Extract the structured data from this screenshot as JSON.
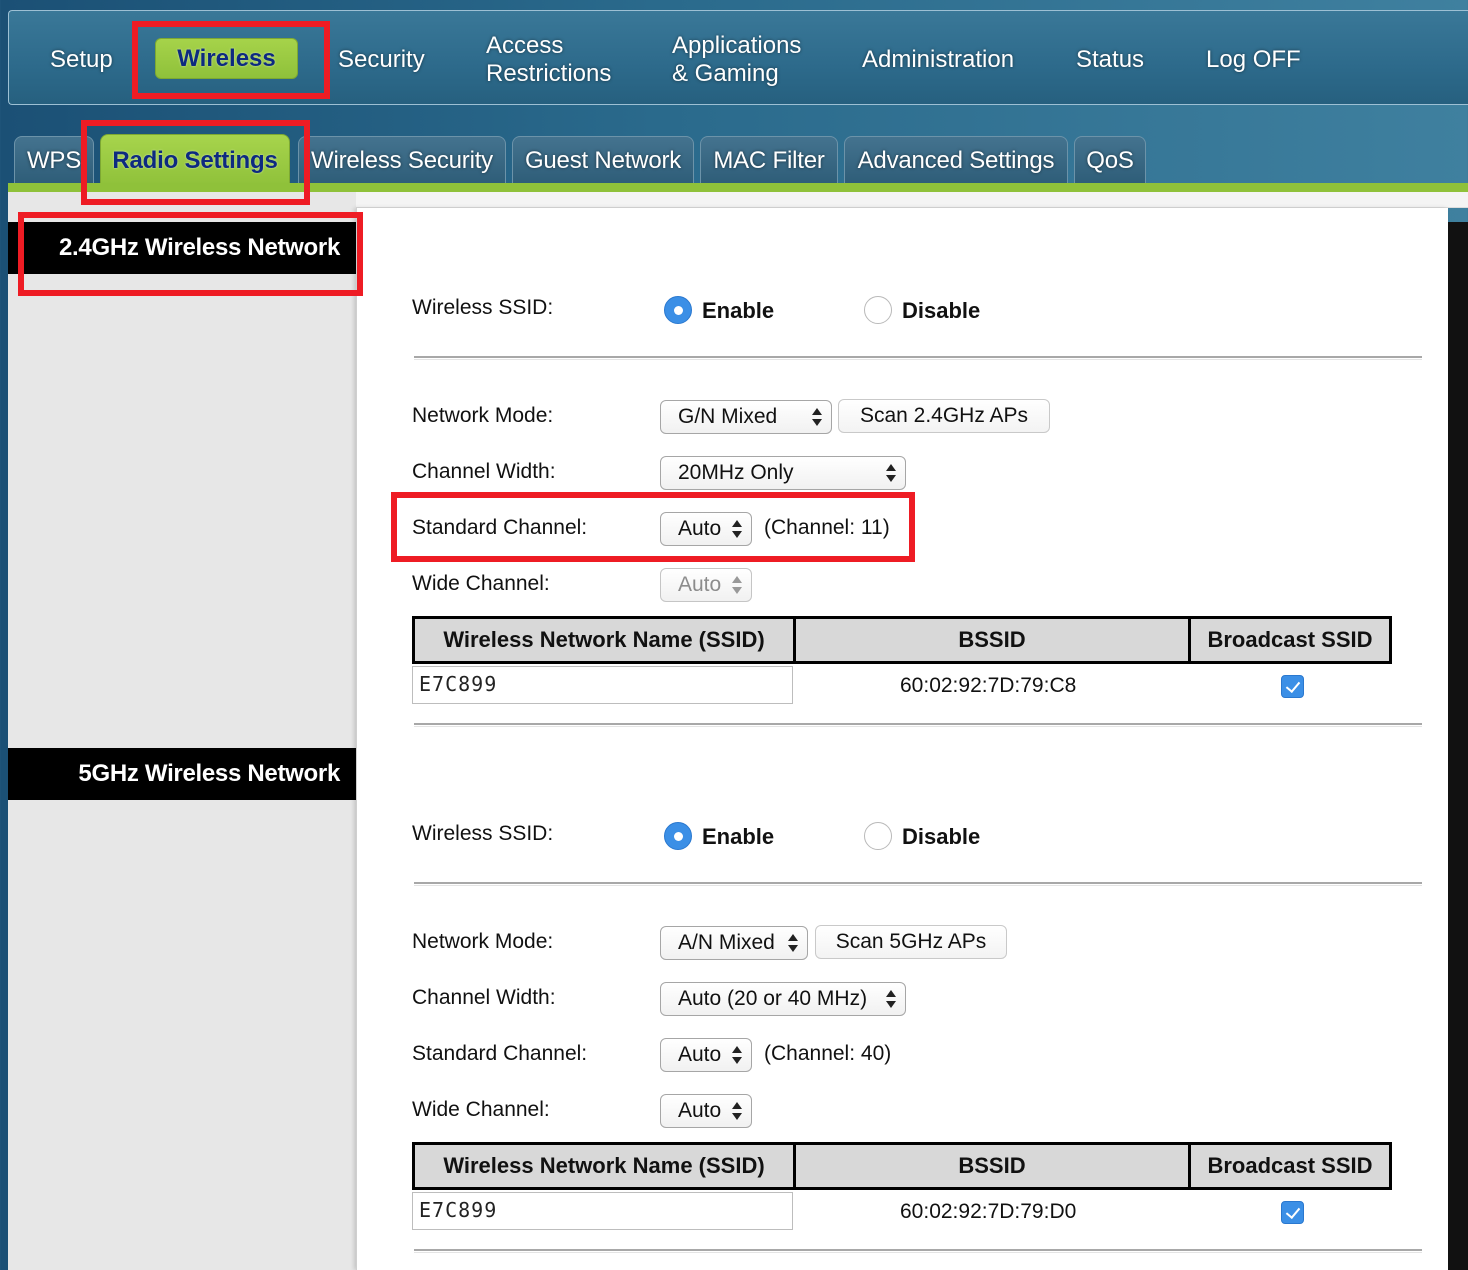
{
  "nav": {
    "setup": "Setup",
    "wireless": "Wireless",
    "security": "Security",
    "access_line1": "Access",
    "access_line2": "Restrictions",
    "apps_line1": "Applications",
    "apps_line2": "& Gaming",
    "administration": "Administration",
    "status": "Status",
    "logoff": "Log OFF"
  },
  "subtabs": {
    "wps": "WPS",
    "radio": "Radio Settings",
    "wireless_security": "Wireless Security",
    "guest": "Guest Network",
    "mac": "MAC Filter",
    "advanced": "Advanced Settings",
    "qos": "QoS"
  },
  "labels": {
    "wireless_ssid": "Wireless SSID:",
    "enable": "Enable",
    "disable": "Disable",
    "network_mode": "Network Mode:",
    "channel_width": "Channel Width:",
    "standard_channel": "Standard Channel:",
    "wide_channel": "Wide Channel:",
    "col_ssid": "Wireless Network Name (SSID)",
    "col_bssid": "BSSID",
    "col_broadcast": "Broadcast SSID"
  },
  "band24": {
    "title": "2.4GHz Wireless Network",
    "network_mode": "G/N Mixed",
    "scan_label": "Scan 2.4GHz APs",
    "channel_width": "20MHz Only",
    "standard_channel": "Auto",
    "channel_note": "(Channel: 11)",
    "wide_channel": "Auto",
    "ssid": "E7C899",
    "bssid": "60:02:92:7D:79:C8"
  },
  "band5": {
    "title": "5GHz Wireless Network",
    "network_mode": "A/N Mixed",
    "scan_label": "Scan 5GHz APs",
    "channel_width": "Auto (20 or 40 MHz)",
    "standard_channel": "Auto",
    "channel_note": "(Channel: 40)",
    "wide_channel": "Auto",
    "ssid": "E7C899",
    "bssid": "60:02:92:7D:79:D0"
  },
  "colors": {
    "accent_green": "#8fc13a",
    "active_text": "#0d2a80",
    "highlight": "#ee1c24",
    "check_blue": "#3b8fe6"
  }
}
